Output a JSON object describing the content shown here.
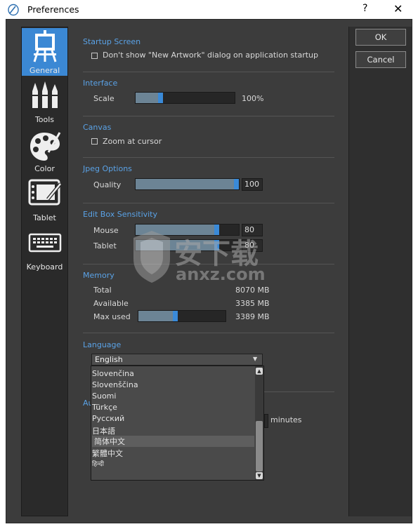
{
  "window": {
    "title": "Preferences",
    "help": "?",
    "close": "✕"
  },
  "sidebar": {
    "items": [
      {
        "label": "General",
        "icon": "easel-icon"
      },
      {
        "label": "Tools",
        "icon": "brushes-icon"
      },
      {
        "label": "Color",
        "icon": "palette-icon"
      },
      {
        "label": "Tablet",
        "icon": "tablet-icon"
      },
      {
        "label": "Keyboard",
        "icon": "keyboard-icon"
      }
    ],
    "active": "General"
  },
  "startup": {
    "title": "Startup Screen",
    "checkbox_label": "Don't show \"New Artwork\" dialog on application startup",
    "checked": false
  },
  "interface": {
    "title": "Interface",
    "scale_label": "Scale",
    "scale_value": "100%",
    "scale_level": 0.24
  },
  "canvas": {
    "title": "Canvas",
    "zoom_label": "Zoom at cursor",
    "checked": false
  },
  "jpeg": {
    "title": "Jpeg Options",
    "quality_label": "Quality",
    "quality_value": "100",
    "quality_level": 1.0
  },
  "editbox": {
    "title": "Edit Box Sensitivity",
    "mouse_label": "Mouse",
    "mouse_value": "80",
    "mouse_level": 0.8,
    "tablet_label": "Tablet",
    "tablet_value": "80",
    "tablet_level": 0.8
  },
  "memory": {
    "title": "Memory",
    "total_label": "Total",
    "total_value": "8070 MB",
    "available_label": "Available",
    "available_value": "3385 MB",
    "maxused_label": "Max used",
    "maxused_value": "3389 MB",
    "maxused_level": 0.42
  },
  "language": {
    "title": "Language",
    "selected": "English",
    "options": [
      "Slovenčina",
      "Slovenščina",
      "Suomi",
      "Türkçe",
      "Русский",
      "日本語",
      "简体中文",
      "繁體中文",
      "हिन्दी"
    ],
    "highlighted": "简体中文"
  },
  "autosave": {
    "title_partial": "Au",
    "minutes_label": "minutes"
  },
  "buttons": {
    "ok": "OK",
    "cancel": "Cancel"
  },
  "watermark": {
    "text_cn": "安下载",
    "text_en": "anxz.com"
  }
}
